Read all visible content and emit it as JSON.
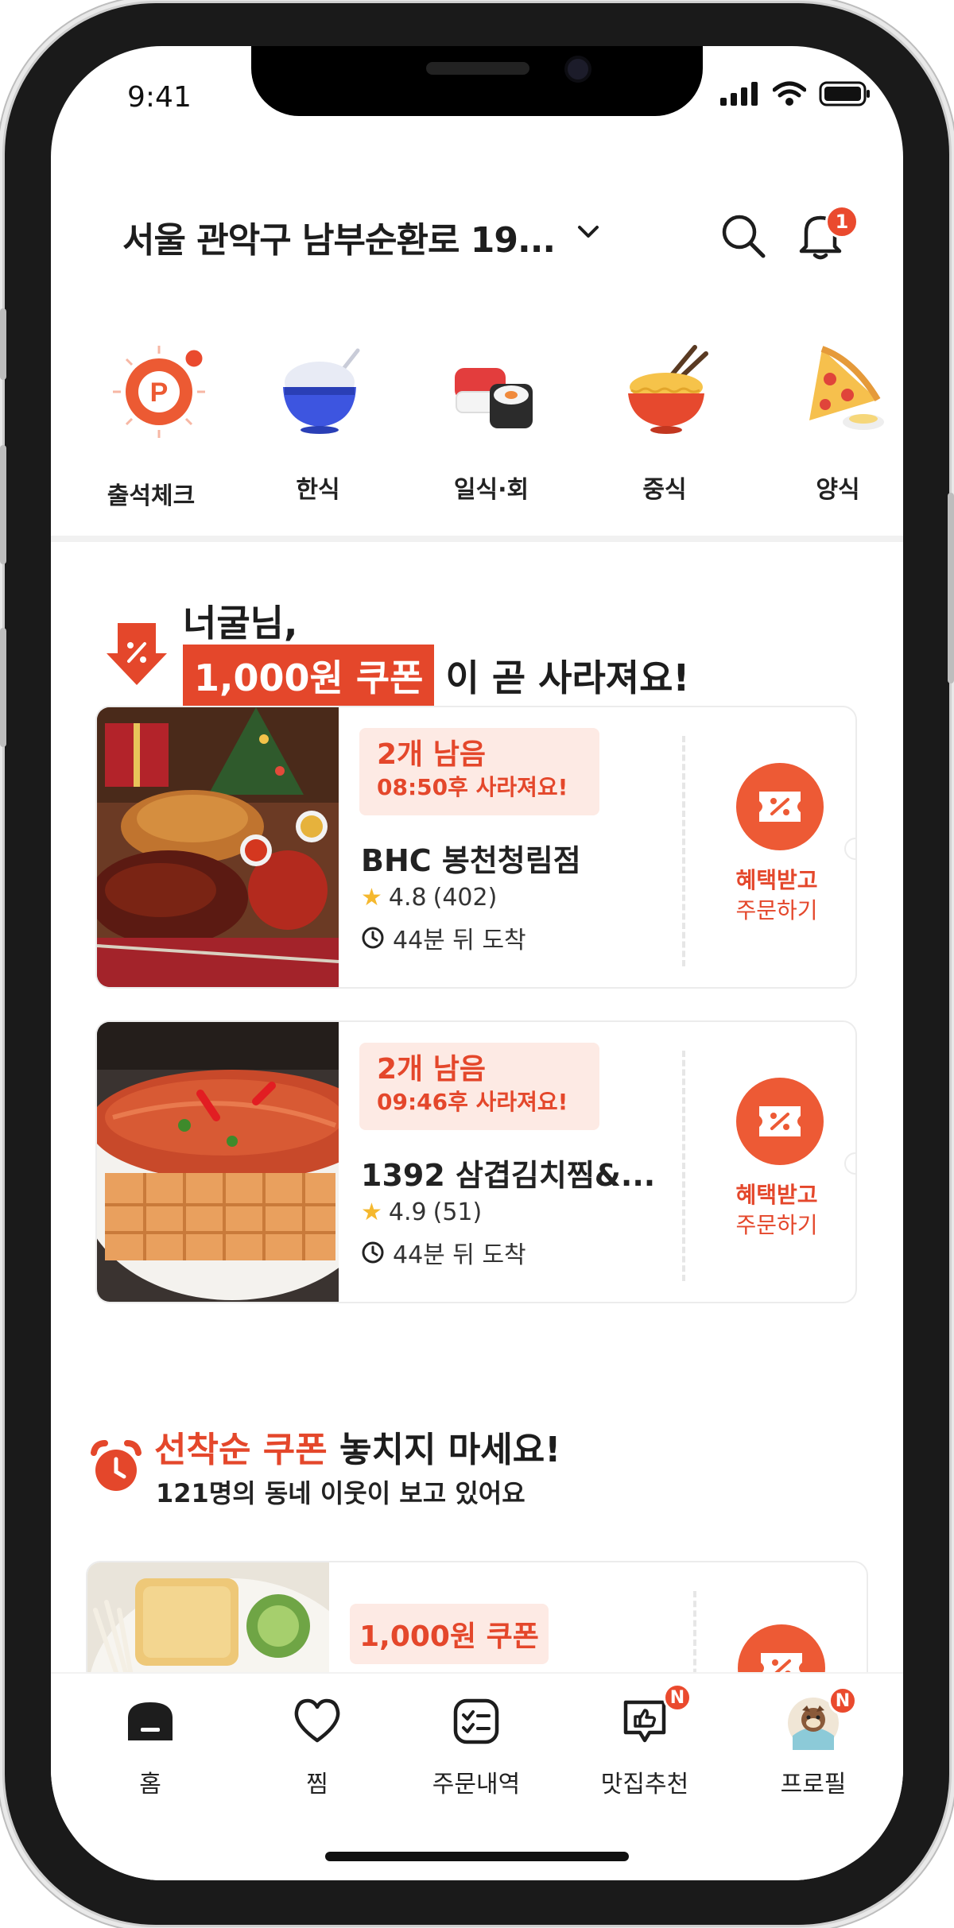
{
  "status_bar": {
    "time": "9:41"
  },
  "header": {
    "address": "서울 관악구 남부순환로 19...",
    "notification_count": "1"
  },
  "categories": [
    {
      "label": "출석체크",
      "icon": "attendance-p-icon"
    },
    {
      "label": "한식",
      "icon": "rice-bowl-icon"
    },
    {
      "label": "일식·회",
      "icon": "sushi-icon"
    },
    {
      "label": "중식",
      "icon": "noodles-icon"
    },
    {
      "label": "양식",
      "icon": "pizza-icon"
    }
  ],
  "greeting": {
    "line1": "너굴님,",
    "coupon": "1,000원 쿠폰",
    "line2_suffix": "이 곧 사라져요!"
  },
  "deals": [
    {
      "remaining": "2개 남음",
      "expires": "08:50후 사라져요!",
      "name": "BHC 봉천청림점",
      "rating": "4.8",
      "reviews": "(402)",
      "eta": "44분 뒤 도착",
      "cta_line1": "혜택받고",
      "cta_line2": "주문하기"
    },
    {
      "remaining": "2개 남음",
      "expires": "09:46후 사라져요!",
      "name": "1392 삼겹김치찜&...",
      "rating": "4.9",
      "reviews": "(51)",
      "eta": "44분 뒤 도착",
      "cta_line1": "혜택받고",
      "cta_line2": "주문하기"
    }
  ],
  "first_come": {
    "accent": "선착순 쿠폰",
    "title_suffix": "놓치지 마세요!",
    "subtitle": "121명의 동네 이웃이 보고 있어요",
    "card_coupon": "1,000원 쿠폰"
  },
  "tabbar": [
    {
      "label": "홈",
      "icon": "home-icon"
    },
    {
      "label": "찜",
      "icon": "heart-icon"
    },
    {
      "label": "주문내역",
      "icon": "order-list-icon"
    },
    {
      "label": "맛집추천",
      "icon": "thumbs-up-icon",
      "badge": "N"
    },
    {
      "label": "프로필",
      "icon": "avatar-icon",
      "badge": "N"
    }
  ],
  "colors": {
    "accent": "#e4472b",
    "accent_light": "#fdeae4"
  }
}
